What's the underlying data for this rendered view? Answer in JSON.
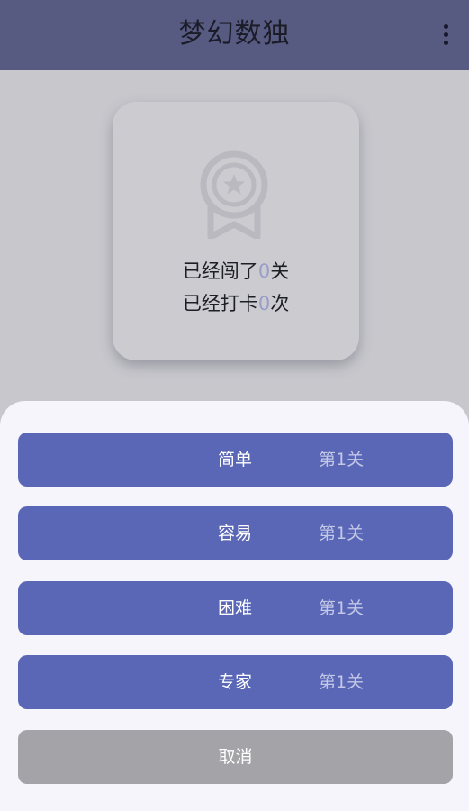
{
  "app_bar": {
    "title": "梦幻数独",
    "menu_icon": "more-vert-icon"
  },
  "stats_card": {
    "icon": "award-badge-icon",
    "levels_prefix": "已经闯了",
    "levels_value": "0",
    "levels_suffix": "关",
    "checkins_prefix": "已经打卡",
    "checkins_value": "0",
    "checkins_suffix": "次"
  },
  "bottom_sheet": {
    "options": [
      {
        "name": "简单",
        "progress": "第1关"
      },
      {
        "name": "容易",
        "progress": "第1关"
      },
      {
        "name": "困难",
        "progress": "第1关"
      },
      {
        "name": "专家",
        "progress": "第1关"
      }
    ],
    "cancel_label": "取消"
  },
  "colors": {
    "app_bar": "#575b82",
    "accent": "#5a67b7",
    "cancel": "#a3a3a8",
    "sheet_background": "#f7f5fc",
    "scrim_background": "#c7c7cc"
  }
}
